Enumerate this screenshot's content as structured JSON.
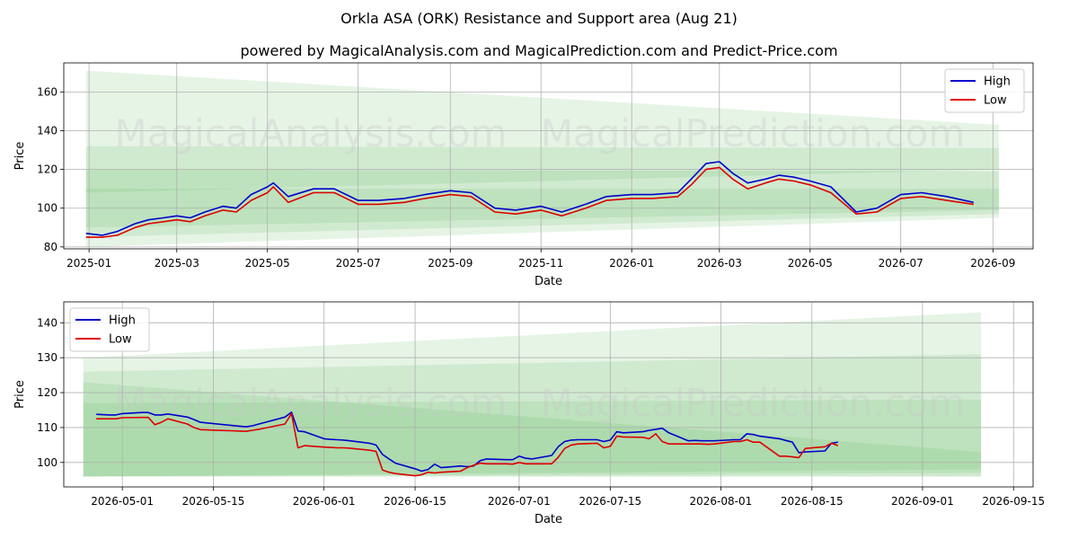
{
  "title": "Orkla ASA (ORK) Resistance and Support area (Aug 21)",
  "subtitle": "powered by MagicalAnalysis.com and MagicalPrediction.com and Predict-Price.com",
  "watermarks": [
    "MagicalAnalysis.com",
    "MagicalPrediction.com"
  ],
  "colors": {
    "high": "#0000cc",
    "low": "#dd0000",
    "band": "#4caf50",
    "grid": "#b0b0b0"
  },
  "chart_data": [
    {
      "type": "line",
      "xlabel": "Date",
      "ylabel": "Price",
      "xlim": [
        "2024-12-15",
        "2026-09-28"
      ],
      "ylim": [
        79,
        175
      ],
      "x_ticks": [
        "2025-01",
        "2025-03",
        "2025-05",
        "2025-07",
        "2025-09",
        "2025-11",
        "2026-01",
        "2026-03",
        "2026-05",
        "2026-07",
        "2026-09"
      ],
      "x_tick_dates": [
        "2025-01-01",
        "2025-03-01",
        "2025-05-01",
        "2025-07-01",
        "2025-09-01",
        "2025-11-01",
        "2026-01-01",
        "2026-03-01",
        "2026-05-01",
        "2026-07-01",
        "2026-09-01"
      ],
      "y_ticks": [
        80,
        100,
        120,
        140,
        160
      ],
      "grid": true,
      "legend": "top-right",
      "bands": [
        {
          "x": [
            "2024-12-30",
            "2026-09-05"
          ],
          "upper": [
            171,
            143
          ],
          "lower": [
            108,
            120
          ]
        },
        {
          "x": [
            "2024-12-30",
            "2026-09-05"
          ],
          "upper": [
            132,
            131
          ],
          "lower": [
            90,
            99
          ]
        },
        {
          "x": [
            "2024-12-30",
            "2026-09-05"
          ],
          "upper": [
            120,
            119
          ],
          "lower": [
            85,
            97
          ]
        },
        {
          "x": [
            "2024-12-30",
            "2026-09-05"
          ],
          "upper": [
            110,
            110
          ],
          "lower": [
            80,
            95
          ]
        }
      ],
      "series": [
        {
          "name": "High",
          "x": [
            "2024-12-30",
            "2025-01-10",
            "2025-01-20",
            "2025-02-01",
            "2025-02-10",
            "2025-02-20",
            "2025-03-01",
            "2025-03-10",
            "2025-03-20",
            "2025-04-01",
            "2025-04-10",
            "2025-04-20",
            "2025-05-01",
            "2025-05-05",
            "2025-05-15",
            "2025-06-01",
            "2025-06-15",
            "2025-07-01",
            "2025-07-15",
            "2025-08-01",
            "2025-08-15",
            "2025-09-01",
            "2025-09-15",
            "2025-10-01",
            "2025-10-15",
            "2025-11-01",
            "2025-11-15",
            "2025-12-01",
            "2025-12-15",
            "2026-01-01",
            "2026-01-15",
            "2026-02-01",
            "2026-02-10",
            "2026-02-20",
            "2026-03-01",
            "2026-03-10",
            "2026-03-20",
            "2026-04-01",
            "2026-04-10",
            "2026-04-20",
            "2026-05-01",
            "2026-05-15",
            "2026-06-01",
            "2026-06-15",
            "2026-07-01",
            "2026-07-15",
            "2026-08-01",
            "2026-08-19"
          ],
          "values": [
            87,
            86,
            88,
            92,
            94,
            95,
            96,
            95,
            98,
            101,
            100,
            107,
            111,
            113,
            106,
            110,
            110,
            104,
            104,
            105,
            107,
            109,
            108,
            100,
            99,
            101,
            98,
            102,
            106,
            107,
            107,
            108,
            115,
            123,
            124,
            118,
            113,
            115,
            117,
            116,
            114,
            111,
            98,
            100,
            107,
            108,
            106,
            103
          ]
        },
        {
          "name": "Low",
          "x": [
            "2024-12-30",
            "2025-01-10",
            "2025-01-20",
            "2025-02-01",
            "2025-02-10",
            "2025-02-20",
            "2025-03-01",
            "2025-03-10",
            "2025-03-20",
            "2025-04-01",
            "2025-04-10",
            "2025-04-20",
            "2025-05-01",
            "2025-05-05",
            "2025-05-15",
            "2025-06-01",
            "2025-06-15",
            "2025-07-01",
            "2025-07-15",
            "2025-08-01",
            "2025-08-15",
            "2025-09-01",
            "2025-09-15",
            "2025-10-01",
            "2025-10-15",
            "2025-11-01",
            "2025-11-15",
            "2025-12-01",
            "2025-12-15",
            "2026-01-01",
            "2026-01-15",
            "2026-02-01",
            "2026-02-10",
            "2026-02-20",
            "2026-03-01",
            "2026-03-10",
            "2026-03-20",
            "2026-04-01",
            "2026-04-10",
            "2026-04-20",
            "2026-05-01",
            "2026-05-15",
            "2026-06-01",
            "2026-06-15",
            "2026-07-01",
            "2026-07-15",
            "2026-08-01",
            "2026-08-19"
          ],
          "values": [
            85,
            85,
            86,
            90,
            92,
            93,
            94,
            93,
            96,
            99,
            98,
            104,
            108,
            111,
            103,
            108,
            108,
            102,
            102,
            103,
            105,
            107,
            106,
            98,
            97,
            99,
            96,
            100,
            104,
            105,
            105,
            106,
            112,
            120,
            121,
            115,
            110,
            113,
            115,
            114,
            112,
            108,
            97,
            98,
            105,
            106,
            104,
            102
          ]
        }
      ]
    },
    {
      "type": "line",
      "xlabel": "Date",
      "ylabel": "Price",
      "xlim": [
        "2026-04-22",
        "2026-09-18"
      ],
      "ylim": [
        93,
        146
      ],
      "x_ticks": [
        "2026-05-01",
        "2026-05-15",
        "2026-06-01",
        "2026-06-15",
        "2026-07-01",
        "2026-07-15",
        "2026-08-01",
        "2026-08-15",
        "2026-09-01",
        "2026-09-15"
      ],
      "y_ticks": [
        100,
        110,
        120,
        130,
        140
      ],
      "grid": true,
      "legend": "top-left",
      "bands": [
        {
          "x": [
            "2026-04-25",
            "2026-09-10"
          ],
          "upper": [
            130,
            143
          ],
          "lower": [
            96,
            96
          ]
        },
        {
          "x": [
            "2026-04-25",
            "2026-09-10"
          ],
          "upper": [
            126,
            131
          ],
          "lower": [
            96,
            96
          ]
        },
        {
          "x": [
            "2026-04-25",
            "2026-09-10"
          ],
          "upper": [
            123,
            103
          ],
          "lower": [
            96,
            97
          ]
        },
        {
          "x": [
            "2026-04-25",
            "2026-09-10"
          ],
          "upper": [
            117,
            118
          ],
          "lower": [
            96,
            98
          ]
        }
      ],
      "series": [
        {
          "name": "High",
          "x": [
            "2026-04-27",
            "2026-04-29",
            "2026-04-30",
            "2026-05-01",
            "2026-05-04",
            "2026-05-05",
            "2026-05-06",
            "2026-05-07",
            "2026-05-08",
            "2026-05-11",
            "2026-05-12",
            "2026-05-13",
            "2026-05-19",
            "2026-05-20",
            "2026-05-21",
            "2026-05-22",
            "2026-05-26",
            "2026-05-27",
            "2026-05-28",
            "2026-05-29",
            "2026-06-01",
            "2026-06-02",
            "2026-06-03",
            "2026-06-04",
            "2026-06-05",
            "2026-06-08",
            "2026-06-09",
            "2026-06-10",
            "2026-06-11",
            "2026-06-12",
            "2026-06-15",
            "2026-06-16",
            "2026-06-17",
            "2026-06-18",
            "2026-06-19",
            "2026-06-22",
            "2026-06-23",
            "2026-06-24",
            "2026-06-25",
            "2026-06-26",
            "2026-06-29",
            "2026-06-30",
            "2026-07-01",
            "2026-07-02",
            "2026-07-03",
            "2026-07-06",
            "2026-07-07",
            "2026-07-08",
            "2026-07-09",
            "2026-07-10",
            "2026-07-13",
            "2026-07-14",
            "2026-07-15",
            "2026-07-16",
            "2026-07-17",
            "2026-07-20",
            "2026-07-21",
            "2026-07-22",
            "2026-07-23",
            "2026-07-24",
            "2026-07-27",
            "2026-07-28",
            "2026-07-29",
            "2026-07-30",
            "2026-07-31",
            "2026-08-03",
            "2026-08-04",
            "2026-08-05",
            "2026-08-06",
            "2026-08-07",
            "2026-08-10",
            "2026-08-11",
            "2026-08-12",
            "2026-08-13",
            "2026-08-14",
            "2026-08-17",
            "2026-08-18",
            "2026-08-19"
          ],
          "values": [
            113.8,
            113.6,
            113.6,
            114.0,
            114.3,
            114.3,
            113.6,
            113.6,
            113.9,
            113.0,
            112.3,
            111.5,
            110.4,
            110.2,
            110.5,
            111.0,
            113.0,
            114.4,
            109.0,
            108.8,
            106.8,
            106.6,
            106.5,
            106.4,
            106.2,
            105.5,
            105.0,
            102.3,
            101.0,
            99.8,
            98.2,
            97.5,
            98.0,
            99.5,
            98.5,
            99.0,
            98.8,
            99.0,
            100.5,
            101.0,
            100.8,
            100.8,
            101.8,
            101.2,
            101.0,
            102.0,
            104.5,
            106.0,
            106.4,
            106.5,
            106.5,
            106.0,
            106.4,
            108.8,
            108.5,
            108.8,
            109.2,
            109.5,
            109.8,
            108.5,
            106.2,
            106.3,
            106.2,
            106.2,
            106.2,
            106.5,
            106.5,
            108.2,
            108.0,
            107.5,
            106.8,
            106.3,
            105.8,
            102.8,
            103.0,
            103.3,
            105.5,
            105.8
          ],
          "_note": ""
        },
        {
          "name": "Low",
          "x": [
            "2026-04-27",
            "2026-04-29",
            "2026-04-30",
            "2026-05-01",
            "2026-05-04",
            "2026-05-05",
            "2026-05-06",
            "2026-05-07",
            "2026-05-08",
            "2026-05-11",
            "2026-05-12",
            "2026-05-13",
            "2026-05-19",
            "2026-05-20",
            "2026-05-21",
            "2026-05-22",
            "2026-05-26",
            "2026-05-27",
            "2026-05-28",
            "2026-05-29",
            "2026-06-01",
            "2026-06-02",
            "2026-06-03",
            "2026-06-04",
            "2026-06-05",
            "2026-06-08",
            "2026-06-09",
            "2026-06-10",
            "2026-06-11",
            "2026-06-12",
            "2026-06-15",
            "2026-06-16",
            "2026-06-17",
            "2026-06-18",
            "2026-06-19",
            "2026-06-22",
            "2026-06-23",
            "2026-06-24",
            "2026-06-25",
            "2026-06-26",
            "2026-06-29",
            "2026-06-30",
            "2026-07-01",
            "2026-07-02",
            "2026-07-03",
            "2026-07-06",
            "2026-07-07",
            "2026-07-08",
            "2026-07-09",
            "2026-07-10",
            "2026-07-13",
            "2026-07-14",
            "2026-07-15",
            "2026-07-16",
            "2026-07-17",
            "2026-07-20",
            "2026-07-21",
            "2026-07-22",
            "2026-07-23",
            "2026-07-24",
            "2026-07-27",
            "2026-07-28",
            "2026-07-29",
            "2026-07-30",
            "2026-07-31",
            "2026-08-03",
            "2026-08-04",
            "2026-08-05",
            "2026-08-06",
            "2026-08-07",
            "2026-08-10",
            "2026-08-11",
            "2026-08-12",
            "2026-08-13",
            "2026-08-14",
            "2026-08-17",
            "2026-08-18",
            "2026-08-19"
          ],
          "values": [
            112.5,
            112.5,
            112.5,
            112.8,
            112.9,
            112.9,
            110.8,
            111.5,
            112.5,
            111.0,
            110.0,
            109.4,
            109.0,
            108.9,
            109.2,
            109.5,
            111.0,
            114.0,
            104.2,
            104.8,
            104.4,
            104.3,
            104.2,
            104.2,
            104.1,
            103.5,
            103.2,
            97.8,
            97.2,
            96.8,
            96.2,
            96.5,
            97.2,
            97.0,
            97.2,
            97.5,
            98.5,
            99.2,
            99.8,
            99.6,
            99.6,
            99.5,
            100.0,
            99.6,
            99.6,
            99.6,
            101.5,
            104.0,
            105.0,
            105.3,
            105.5,
            104.2,
            104.6,
            107.5,
            107.3,
            107.2,
            106.8,
            108.2,
            106.0,
            105.3,
            105.3,
            105.3,
            105.3,
            105.2,
            105.3,
            106.0,
            106.0,
            106.5,
            105.8,
            105.8,
            101.8,
            101.8,
            101.6,
            101.4,
            104.0,
            104.5,
            105.5,
            104.8
          ]
        }
      ]
    }
  ]
}
